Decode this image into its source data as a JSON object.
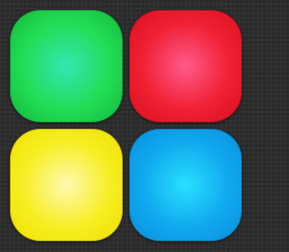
{
  "pads": [
    {
      "id": "green",
      "color": "#22dd55",
      "highlight": "#33e6b4",
      "shade": "#14b83c"
    },
    {
      "id": "red",
      "color": "#f02033",
      "highlight": "#ff5a8c",
      "shade": "#d8101f"
    },
    {
      "id": "yellow",
      "color": "#f7ee22",
      "highlight": "#fff9b0",
      "shade": "#f0e000"
    },
    {
      "id": "blue",
      "color": "#10a8ee",
      "highlight": "#28e0ff",
      "shade": "#0a8edb"
    }
  ]
}
